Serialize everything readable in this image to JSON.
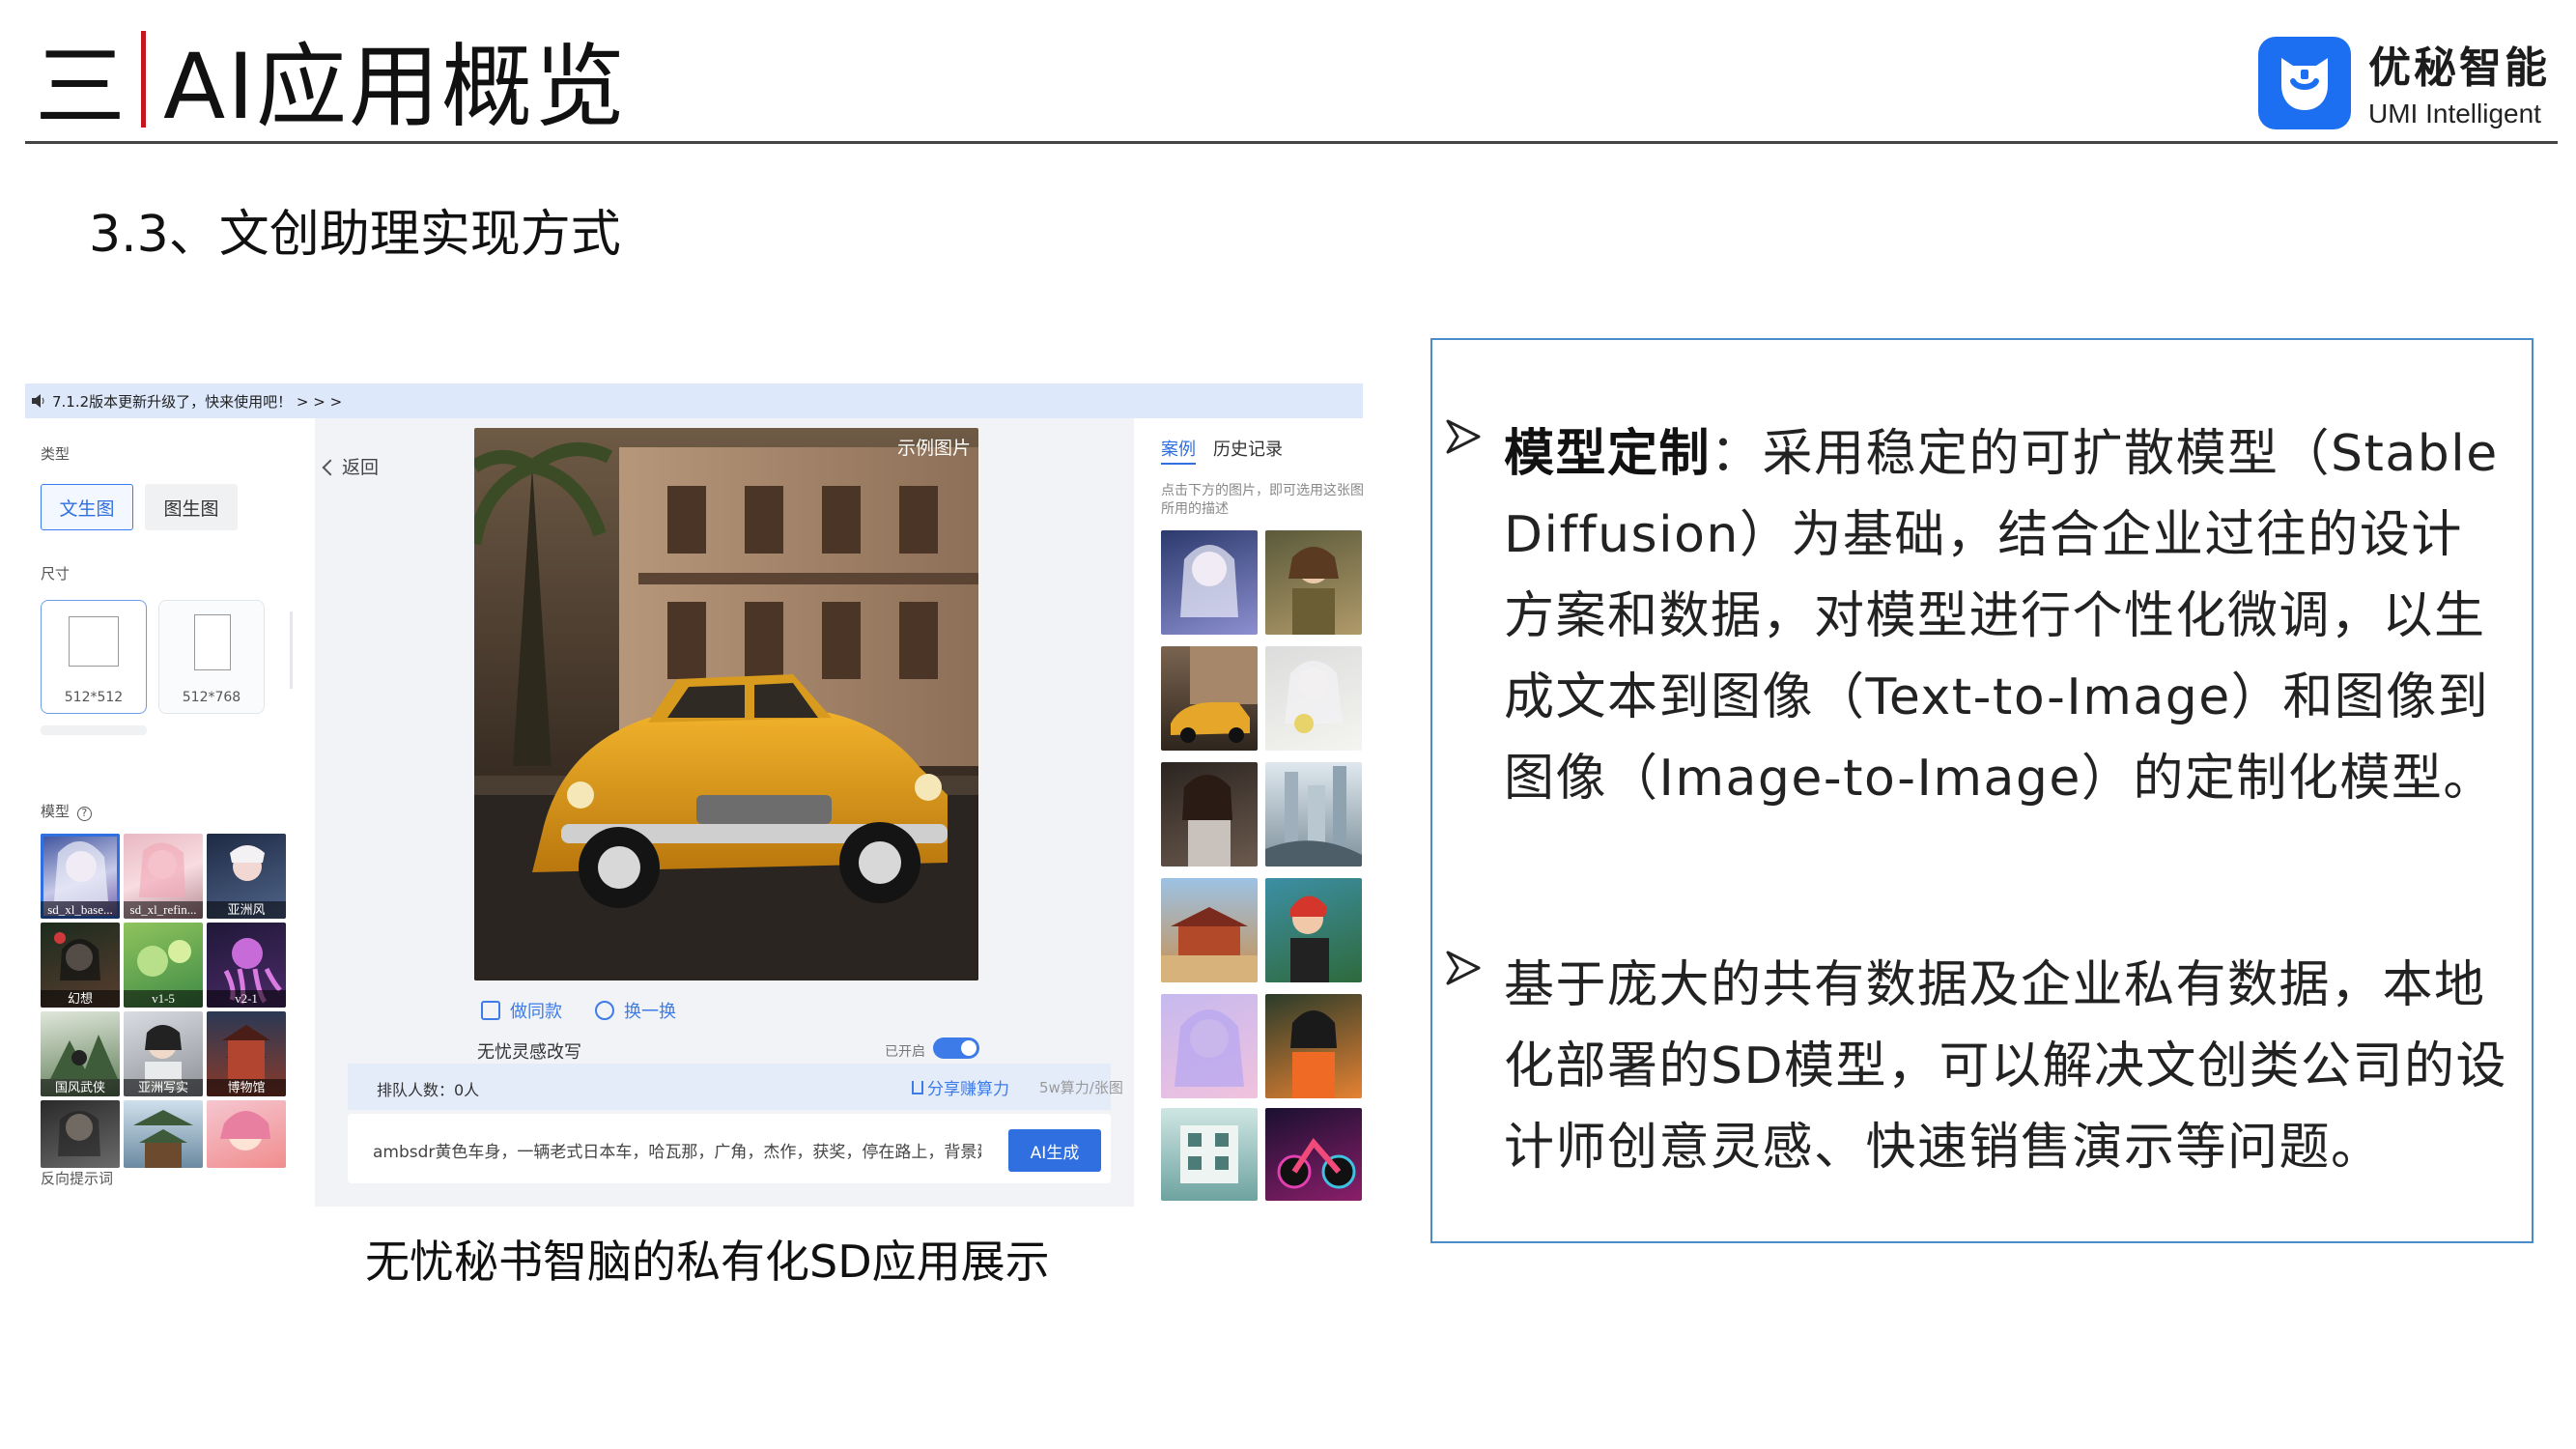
{
  "header": {
    "title_prefix": "三",
    "title_main": "AI应用概览",
    "logo_name": "优秘智能",
    "logo_subtitle": "UMI Intelligent"
  },
  "section": {
    "title": "3.3、文创助理实现方式"
  },
  "app": {
    "notice": "7.1.2版本更新升级了，快来使用吧！ > > >",
    "left": {
      "type_label": "类型",
      "type_buttons": [
        "文生图",
        "图生图"
      ],
      "size_label": "尺寸",
      "sizes": [
        "512*512",
        "512*768"
      ],
      "model_label": "模型",
      "models": [
        "sd_xl_base...",
        "sd_xl_refin...",
        "亚洲风",
        "幻想",
        "v1-5",
        "v2-1",
        "国风武侠",
        "亚洲写实",
        "博物馆",
        "",
        "",
        ""
      ],
      "negative_prompt_label": "反向提示词"
    },
    "center": {
      "back": "返回",
      "example_tag": "示例图片",
      "action_same": "做同款",
      "action_swap": "换一换",
      "rewrite_label": "无忧灵感改写",
      "rewrite_status": "已开启",
      "queue": "排队人数：0人",
      "share": "分享赚算力",
      "compute_note": "5w算力/张图",
      "prompt": "ambsdr黄色车身，一辆老式日本车，哈瓦那，广角，杰作，获奖，停在路上，背景建筑，",
      "generate": "AI生成"
    },
    "right": {
      "tabs": [
        "案例",
        "历史记录"
      ],
      "hint": "点击下方的图片，即可选用这张图所用的描述"
    }
  },
  "caption": "无忧秘书智脑的私有化SD应用展示",
  "description": {
    "para1_bold": "模型定制",
    "para1_text": "：采用稳定的可扩散模型（Stable Diffusion）为基础，结合企业过往的设计方案和数据，对模型进行个性化微调，以生成文本到图像（Text-to-Image）和图像到图像（Image-to-Image）的定制化模型。",
    "para2_text": "基于庞大的共有数据及企业私有数据，本地化部署的SD模型，可以解决文创类公司的设计师创意灵感、快速销售演示等问题。"
  },
  "colors": {
    "accent_blue": "#2f6fe0",
    "title_red_bar": "#c4161c",
    "box_border": "#4a8cc9",
    "logo_blue": "#1d6ff2"
  }
}
